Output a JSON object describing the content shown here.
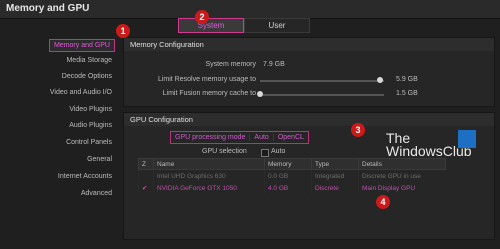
{
  "window": {
    "title": "Memory and GPU"
  },
  "tabs": [
    {
      "label": "System"
    },
    {
      "label": "User"
    }
  ],
  "sidebar": {
    "items": [
      {
        "label": "Memory and GPU"
      },
      {
        "label": "Media Storage"
      },
      {
        "label": "Decode Options"
      },
      {
        "label": "Video and Audio I/O"
      },
      {
        "label": "Video Plugins"
      },
      {
        "label": "Audio Plugins"
      },
      {
        "label": "Control Panels"
      },
      {
        "label": "General"
      },
      {
        "label": "Internet Accounts"
      },
      {
        "label": "Advanced"
      }
    ]
  },
  "memory": {
    "title": "Memory Configuration",
    "system_memory_label": "System memory",
    "system_memory_value": "7.9 GB",
    "resolve_label": "Limit Resolve memory usage to",
    "resolve_value": "5.9 GB",
    "resolve_level": 0.97,
    "fusion_label": "Limit Fusion memory cache to",
    "fusion_value": "1.5 GB",
    "fusion_level": 0.0
  },
  "gpu": {
    "title": "GPU Configuration",
    "mode_label": "GPU processing mode",
    "mode_value": "Auto",
    "api_value": "OpenCL",
    "selection_label": "GPU selection",
    "selection_auto": "Auto",
    "columns": [
      "Z",
      "Name",
      "Memory",
      "Type",
      "Details"
    ],
    "rows": [
      {
        "check": "",
        "name": "Intel UHD Graphics 630",
        "memory": "0.0 GB",
        "type": "Integrated",
        "details": "Discrete GPU in use"
      },
      {
        "check": "✔",
        "name": "NVIDIA GeForce GTX 1050",
        "memory": "4.0 GB",
        "type": "Discrete",
        "details": "Main Display GPU"
      }
    ]
  },
  "badges": [
    "1",
    "2",
    "3",
    "4"
  ],
  "watermark": {
    "line1": "The",
    "line2": "WindowsClub"
  }
}
